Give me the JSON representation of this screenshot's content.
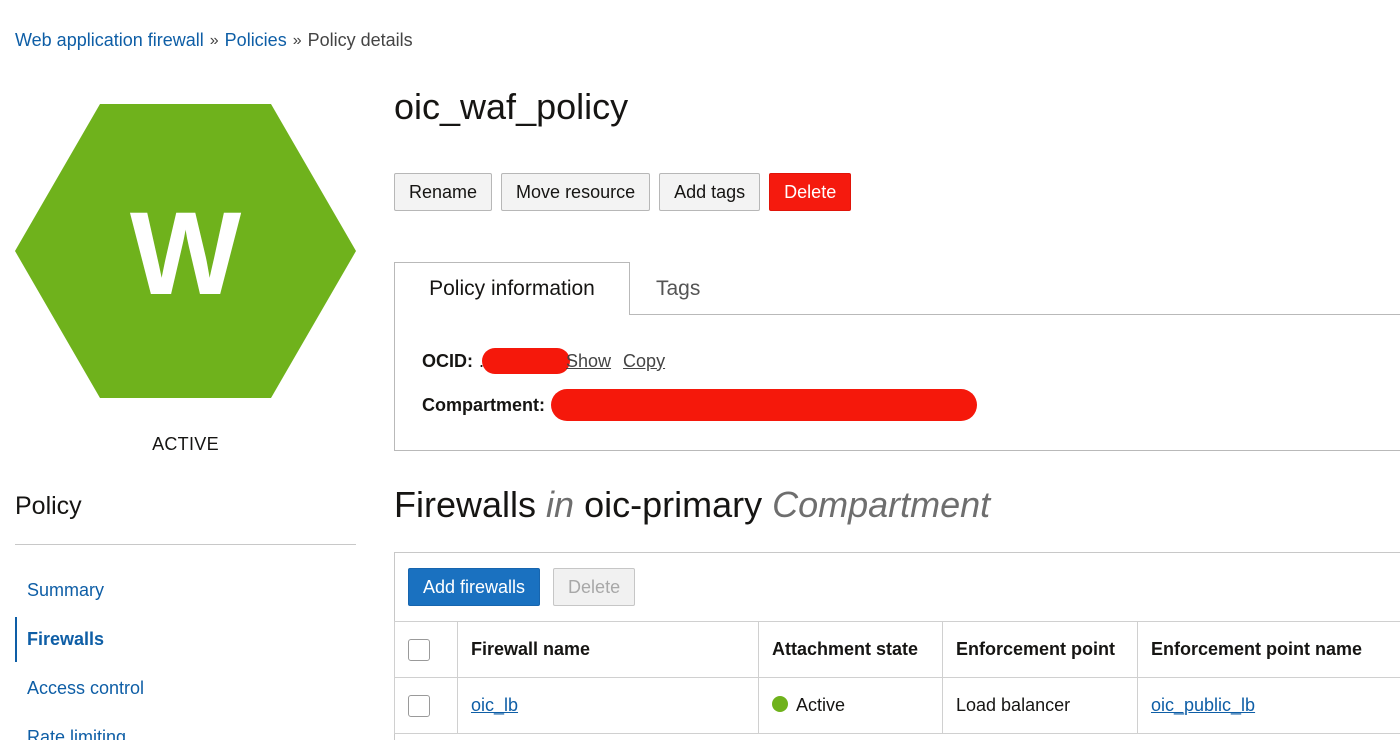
{
  "breadcrumb": {
    "items": [
      "Web application firewall",
      "Policies"
    ],
    "separator": "»",
    "current": "Policy details"
  },
  "resource": {
    "icon_letter": "W",
    "icon_color": "#6fb21c",
    "status": "ACTIVE"
  },
  "left_nav": {
    "title": "Policy",
    "items": [
      {
        "label": "Summary",
        "active": false
      },
      {
        "label": "Firewalls",
        "active": true
      },
      {
        "label": "Access control",
        "active": false
      },
      {
        "label": "Rate limiting",
        "active": false
      }
    ]
  },
  "header": {
    "title": "oic_waf_policy",
    "actions": {
      "rename": "Rename",
      "move": "Move resource",
      "add_tags": "Add tags",
      "delete": "Delete"
    }
  },
  "tabs": {
    "policy_info": "Policy information",
    "tags": "Tags"
  },
  "policy_info": {
    "ocid_label": "OCID:",
    "ocid_prefix": ".",
    "show_link": "Show",
    "copy_link": "Copy",
    "compartment_label": "Compartment:"
  },
  "firewalls_section": {
    "title_main": "Firewalls",
    "title_in": "in",
    "compartment_name": "oic-primary",
    "title_suffix": "Compartment",
    "add_button": "Add firewalls",
    "delete_button": "Delete",
    "columns": [
      "Firewall name",
      "Attachment state",
      "Enforcement point",
      "Enforcement point name"
    ],
    "rows": [
      {
        "name": "oic_lb",
        "state": "Active",
        "enforcement_point": "Load balancer",
        "enforcement_point_name": "oic_public_lb"
      }
    ]
  },
  "colors": {
    "link": "#0e5ea6",
    "danger": "#f51a0e",
    "primary": "#1a71c0",
    "active_status": "#6fb21c"
  }
}
